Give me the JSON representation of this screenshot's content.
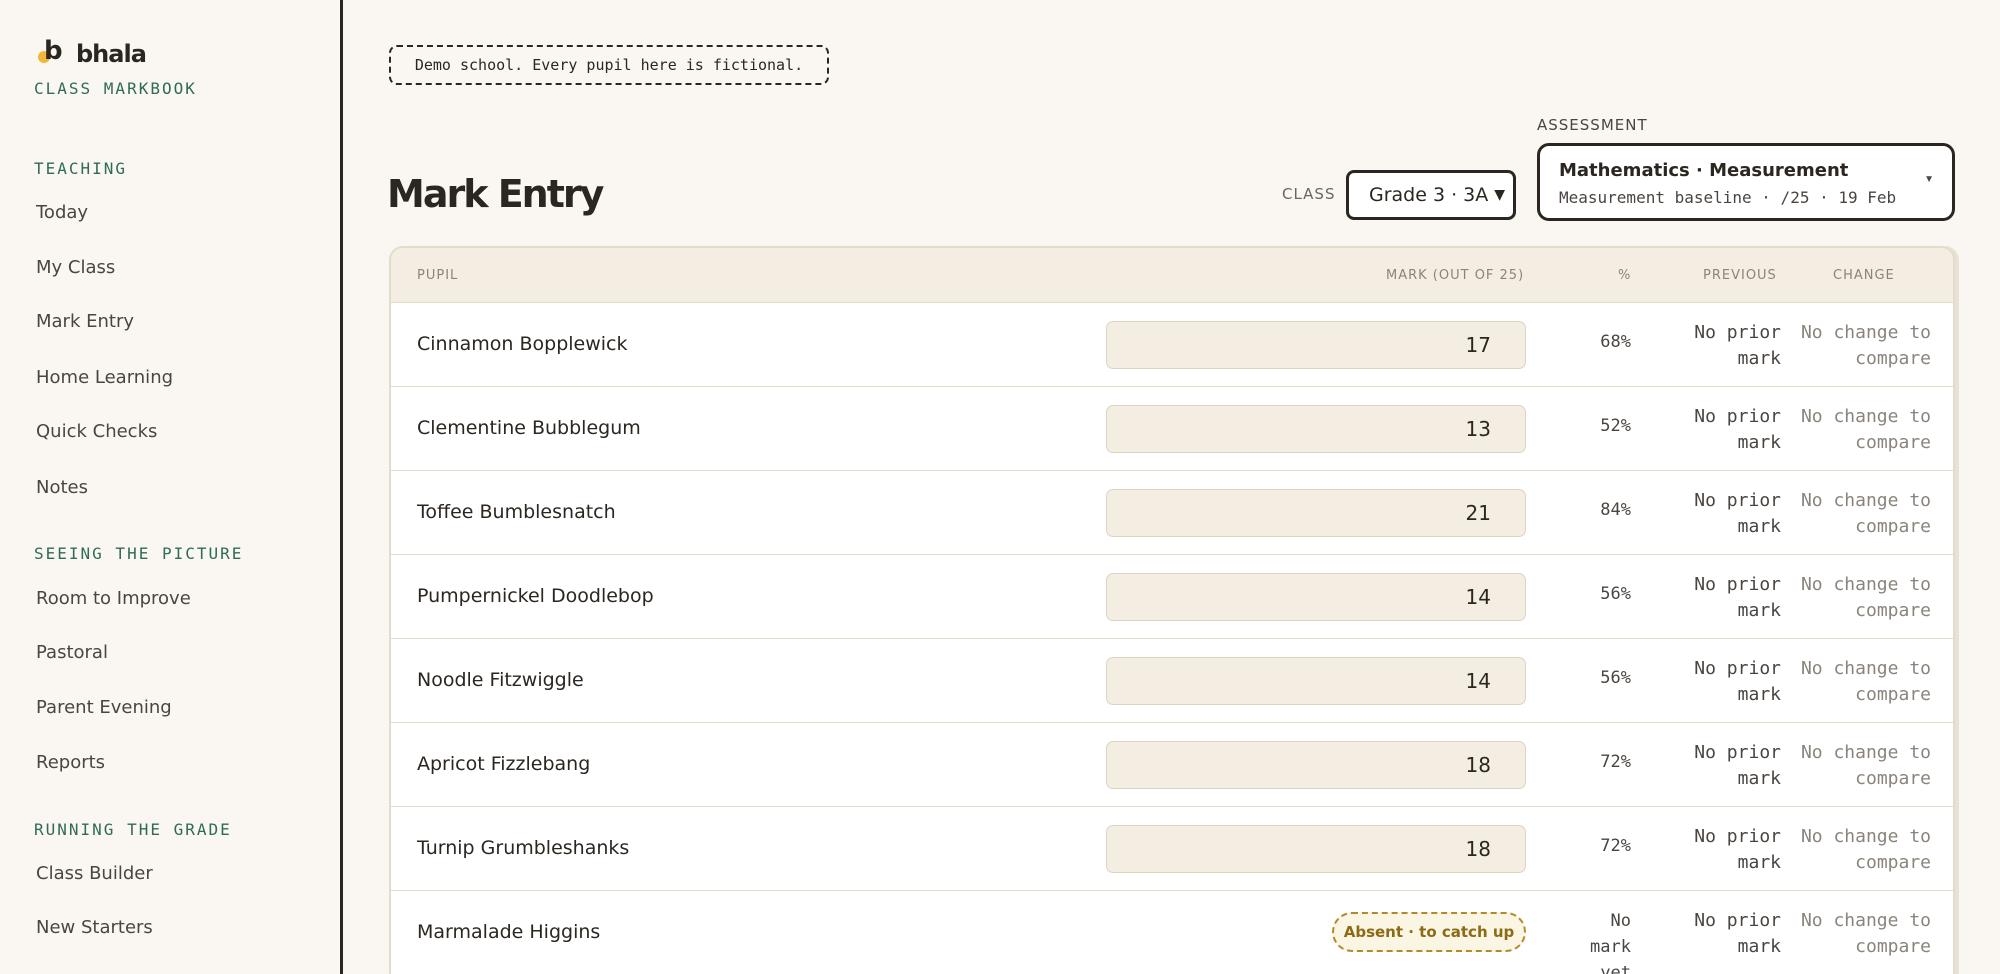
{
  "sidebar": {
    "brand_name": "bhala",
    "brand_sub": "CLASS MARKBOOK",
    "sections": [
      {
        "title": "TEACHING",
        "items": [
          "Today",
          "My Class",
          "Mark Entry",
          "Home Learning",
          "Quick Checks",
          "Notes"
        ]
      },
      {
        "title": "SEEING THE PICTURE",
        "items": [
          "Room to Improve",
          "Pastoral",
          "Parent Evening",
          "Reports"
        ]
      },
      {
        "title": "RUNNING THE GRADE",
        "items": [
          "Class Builder",
          "New Starters"
        ]
      }
    ]
  },
  "banner": "Demo school. Every pupil here is fictional.",
  "page_title": "Mark Entry",
  "class_filter": {
    "label": "CLASS",
    "value": "Grade 3 · 3A"
  },
  "assessment": {
    "label": "ASSESSMENT",
    "title": "Mathematics · Measurement",
    "subtitle": "Measurement baseline · /25 · 19 Feb"
  },
  "table": {
    "headers": {
      "pupil": "PUPIL",
      "mark": "MARK (OUT OF 25)",
      "pct": "%",
      "previous": "PREVIOUS",
      "change": "CHANGE"
    },
    "rows": [
      {
        "pupil": "Cinnamon Bopplewick",
        "mark": "17",
        "pct": "68%",
        "previous": [
          "No prior",
          "mark"
        ],
        "change": [
          "No change to",
          "compare"
        ]
      },
      {
        "pupil": "Clementine Bubblegum",
        "mark": "13",
        "pct": "52%",
        "previous": [
          "No prior",
          "mark"
        ],
        "change": [
          "No change to",
          "compare"
        ]
      },
      {
        "pupil": "Toffee Bumblesnatch",
        "mark": "21",
        "pct": "84%",
        "previous": [
          "No prior",
          "mark"
        ],
        "change": [
          "No change to",
          "compare"
        ]
      },
      {
        "pupil": "Pumpernickel Doodlebop",
        "mark": "14",
        "pct": "56%",
        "previous": [
          "No prior",
          "mark"
        ],
        "change": [
          "No change to",
          "compare"
        ]
      },
      {
        "pupil": "Noodle Fitzwiggle",
        "mark": "14",
        "pct": "56%",
        "previous": [
          "No prior",
          "mark"
        ],
        "change": [
          "No change to",
          "compare"
        ]
      },
      {
        "pupil": "Apricot Fizzlebang",
        "mark": "18",
        "pct": "72%",
        "previous": [
          "No prior",
          "mark"
        ],
        "change": [
          "No change to",
          "compare"
        ]
      },
      {
        "pupil": "Turnip Grumbleshanks",
        "mark": "18",
        "pct": "72%",
        "previous": [
          "No prior",
          "mark"
        ],
        "change": [
          "No change to",
          "compare"
        ]
      },
      {
        "pupil": "Marmalade Higgins",
        "status": "Absent · to catch up",
        "pct": [
          "No mark",
          "yet"
        ],
        "previous": [
          "No prior",
          "mark"
        ],
        "change": [
          "No change to",
          "compare"
        ]
      }
    ]
  },
  "colors": {
    "accent_green": "#2f6b55",
    "brand_yellow": "#f2b63a",
    "absent_gold": "#b28a2a"
  }
}
